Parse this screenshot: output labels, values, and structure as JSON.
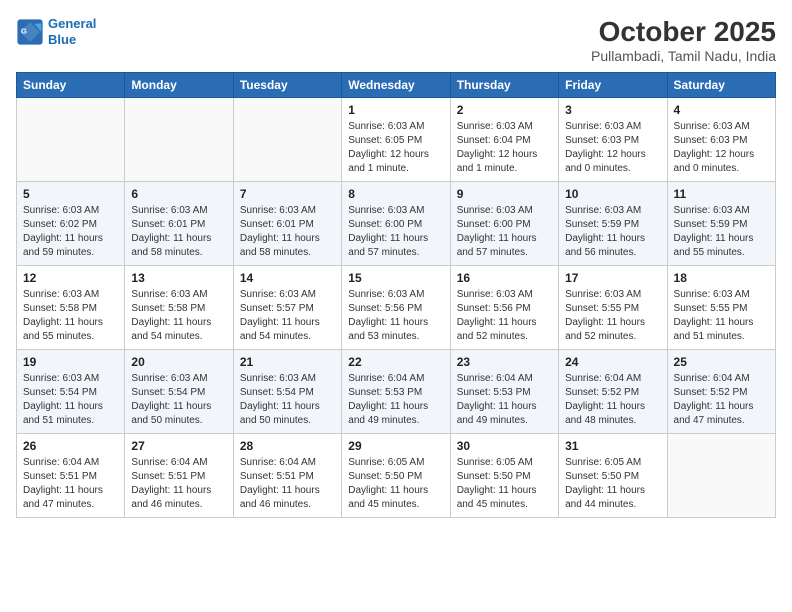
{
  "header": {
    "logo_line1": "General",
    "logo_line2": "Blue",
    "month": "October 2025",
    "location": "Pullambadi, Tamil Nadu, India"
  },
  "days": [
    "Sunday",
    "Monday",
    "Tuesday",
    "Wednesday",
    "Thursday",
    "Friday",
    "Saturday"
  ],
  "weeks": [
    [
      {
        "date": "",
        "sunrise": "",
        "sunset": "",
        "daylight": ""
      },
      {
        "date": "",
        "sunrise": "",
        "sunset": "",
        "daylight": ""
      },
      {
        "date": "",
        "sunrise": "",
        "sunset": "",
        "daylight": ""
      },
      {
        "date": "1",
        "sunrise": "Sunrise: 6:03 AM",
        "sunset": "Sunset: 6:05 PM",
        "daylight": "Daylight: 12 hours and 1 minute."
      },
      {
        "date": "2",
        "sunrise": "Sunrise: 6:03 AM",
        "sunset": "Sunset: 6:04 PM",
        "daylight": "Daylight: 12 hours and 1 minute."
      },
      {
        "date": "3",
        "sunrise": "Sunrise: 6:03 AM",
        "sunset": "Sunset: 6:03 PM",
        "daylight": "Daylight: 12 hours and 0 minutes."
      },
      {
        "date": "4",
        "sunrise": "Sunrise: 6:03 AM",
        "sunset": "Sunset: 6:03 PM",
        "daylight": "Daylight: 12 hours and 0 minutes."
      }
    ],
    [
      {
        "date": "5",
        "sunrise": "Sunrise: 6:03 AM",
        "sunset": "Sunset: 6:02 PM",
        "daylight": "Daylight: 11 hours and 59 minutes."
      },
      {
        "date": "6",
        "sunrise": "Sunrise: 6:03 AM",
        "sunset": "Sunset: 6:01 PM",
        "daylight": "Daylight: 11 hours and 58 minutes."
      },
      {
        "date": "7",
        "sunrise": "Sunrise: 6:03 AM",
        "sunset": "Sunset: 6:01 PM",
        "daylight": "Daylight: 11 hours and 58 minutes."
      },
      {
        "date": "8",
        "sunrise": "Sunrise: 6:03 AM",
        "sunset": "Sunset: 6:00 PM",
        "daylight": "Daylight: 11 hours and 57 minutes."
      },
      {
        "date": "9",
        "sunrise": "Sunrise: 6:03 AM",
        "sunset": "Sunset: 6:00 PM",
        "daylight": "Daylight: 11 hours and 57 minutes."
      },
      {
        "date": "10",
        "sunrise": "Sunrise: 6:03 AM",
        "sunset": "Sunset: 5:59 PM",
        "daylight": "Daylight: 11 hours and 56 minutes."
      },
      {
        "date": "11",
        "sunrise": "Sunrise: 6:03 AM",
        "sunset": "Sunset: 5:59 PM",
        "daylight": "Daylight: 11 hours and 55 minutes."
      }
    ],
    [
      {
        "date": "12",
        "sunrise": "Sunrise: 6:03 AM",
        "sunset": "Sunset: 5:58 PM",
        "daylight": "Daylight: 11 hours and 55 minutes."
      },
      {
        "date": "13",
        "sunrise": "Sunrise: 6:03 AM",
        "sunset": "Sunset: 5:58 PM",
        "daylight": "Daylight: 11 hours and 54 minutes."
      },
      {
        "date": "14",
        "sunrise": "Sunrise: 6:03 AM",
        "sunset": "Sunset: 5:57 PM",
        "daylight": "Daylight: 11 hours and 54 minutes."
      },
      {
        "date": "15",
        "sunrise": "Sunrise: 6:03 AM",
        "sunset": "Sunset: 5:56 PM",
        "daylight": "Daylight: 11 hours and 53 minutes."
      },
      {
        "date": "16",
        "sunrise": "Sunrise: 6:03 AM",
        "sunset": "Sunset: 5:56 PM",
        "daylight": "Daylight: 11 hours and 52 minutes."
      },
      {
        "date": "17",
        "sunrise": "Sunrise: 6:03 AM",
        "sunset": "Sunset: 5:55 PM",
        "daylight": "Daylight: 11 hours and 52 minutes."
      },
      {
        "date": "18",
        "sunrise": "Sunrise: 6:03 AM",
        "sunset": "Sunset: 5:55 PM",
        "daylight": "Daylight: 11 hours and 51 minutes."
      }
    ],
    [
      {
        "date": "19",
        "sunrise": "Sunrise: 6:03 AM",
        "sunset": "Sunset: 5:54 PM",
        "daylight": "Daylight: 11 hours and 51 minutes."
      },
      {
        "date": "20",
        "sunrise": "Sunrise: 6:03 AM",
        "sunset": "Sunset: 5:54 PM",
        "daylight": "Daylight: 11 hours and 50 minutes."
      },
      {
        "date": "21",
        "sunrise": "Sunrise: 6:03 AM",
        "sunset": "Sunset: 5:54 PM",
        "daylight": "Daylight: 11 hours and 50 minutes."
      },
      {
        "date": "22",
        "sunrise": "Sunrise: 6:04 AM",
        "sunset": "Sunset: 5:53 PM",
        "daylight": "Daylight: 11 hours and 49 minutes."
      },
      {
        "date": "23",
        "sunrise": "Sunrise: 6:04 AM",
        "sunset": "Sunset: 5:53 PM",
        "daylight": "Daylight: 11 hours and 49 minutes."
      },
      {
        "date": "24",
        "sunrise": "Sunrise: 6:04 AM",
        "sunset": "Sunset: 5:52 PM",
        "daylight": "Daylight: 11 hours and 48 minutes."
      },
      {
        "date": "25",
        "sunrise": "Sunrise: 6:04 AM",
        "sunset": "Sunset: 5:52 PM",
        "daylight": "Daylight: 11 hours and 47 minutes."
      }
    ],
    [
      {
        "date": "26",
        "sunrise": "Sunrise: 6:04 AM",
        "sunset": "Sunset: 5:51 PM",
        "daylight": "Daylight: 11 hours and 47 minutes."
      },
      {
        "date": "27",
        "sunrise": "Sunrise: 6:04 AM",
        "sunset": "Sunset: 5:51 PM",
        "daylight": "Daylight: 11 hours and 46 minutes."
      },
      {
        "date": "28",
        "sunrise": "Sunrise: 6:04 AM",
        "sunset": "Sunset: 5:51 PM",
        "daylight": "Daylight: 11 hours and 46 minutes."
      },
      {
        "date": "29",
        "sunrise": "Sunrise: 6:05 AM",
        "sunset": "Sunset: 5:50 PM",
        "daylight": "Daylight: 11 hours and 45 minutes."
      },
      {
        "date": "30",
        "sunrise": "Sunrise: 6:05 AM",
        "sunset": "Sunset: 5:50 PM",
        "daylight": "Daylight: 11 hours and 45 minutes."
      },
      {
        "date": "31",
        "sunrise": "Sunrise: 6:05 AM",
        "sunset": "Sunset: 5:50 PM",
        "daylight": "Daylight: 11 hours and 44 minutes."
      },
      {
        "date": "",
        "sunrise": "",
        "sunset": "",
        "daylight": ""
      }
    ]
  ]
}
